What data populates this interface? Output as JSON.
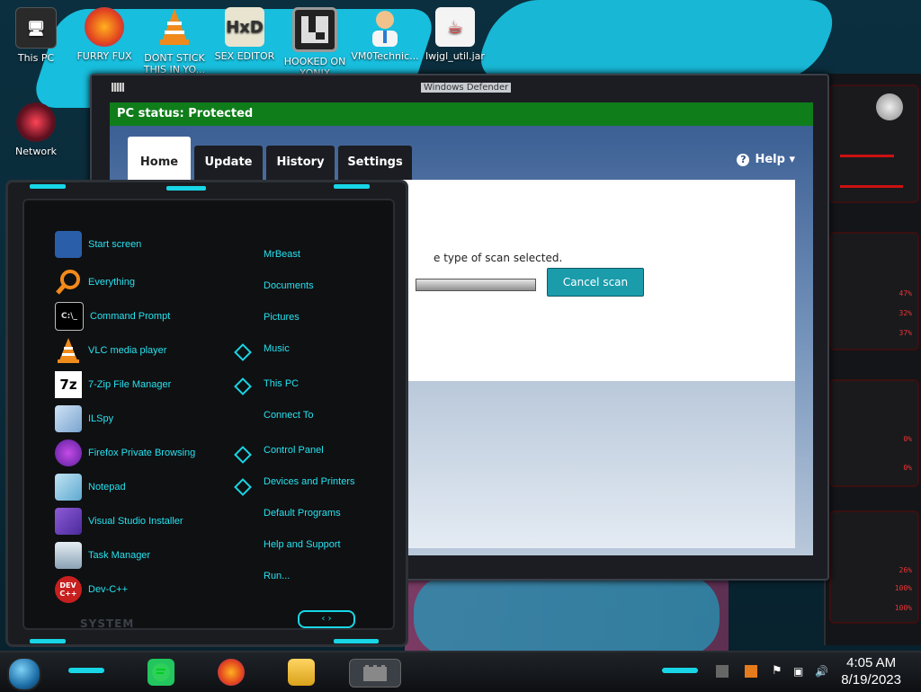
{
  "desktop": {
    "icons": [
      {
        "label": "This PC"
      },
      {
        "label": "FURRY FUX"
      },
      {
        "label": "DONT STICK THIS IN YO..."
      },
      {
        "label": "SEX EDITOR"
      },
      {
        "label": "HOOKED ON XONIX"
      },
      {
        "label": "VM0Technic..."
      },
      {
        "label": "lwjgl_util.jar"
      },
      {
        "label": "Network"
      }
    ]
  },
  "defender": {
    "window_title": "Windows Defender",
    "status": "PC status: Protected",
    "tabs": [
      {
        "label": "Home"
      },
      {
        "label": "Update"
      },
      {
        "label": "History"
      },
      {
        "label": "Settings"
      }
    ],
    "help_label": "Help",
    "scan_text": "e type of scan selected.",
    "cancel_label": "Cancel scan",
    "scan_progress": 0.95
  },
  "startmenu": {
    "apps": [
      {
        "label": "Start screen",
        "icon": "start-screen-icon"
      },
      {
        "label": "Everything",
        "icon": "magnifier-icon"
      },
      {
        "label": "Command Prompt",
        "icon": "console-icon"
      },
      {
        "label": "VLC media player",
        "icon": "vlc-cone-icon"
      },
      {
        "label": "7-Zip File Manager",
        "icon": "7zip-icon"
      },
      {
        "label": "ILSpy",
        "icon": "ilspy-icon"
      },
      {
        "label": "Firefox Private Browsing",
        "icon": "firefox-private-icon"
      },
      {
        "label": "Notepad",
        "icon": "notepad-icon"
      },
      {
        "label": "Visual Studio Installer",
        "icon": "vs-installer-icon"
      },
      {
        "label": "Task Manager",
        "icon": "task-manager-icon"
      },
      {
        "label": "Dev-C++",
        "icon": "devcpp-icon"
      }
    ],
    "places": [
      {
        "label": "MrBeast"
      },
      {
        "label": "Documents"
      },
      {
        "label": "Pictures"
      },
      {
        "label": "Music"
      },
      {
        "label": "This PC"
      },
      {
        "label": "Connect To"
      },
      {
        "label": "Control Panel"
      },
      {
        "label": "Devices and Printers"
      },
      {
        "label": "Default Programs"
      },
      {
        "label": "Help and Support"
      },
      {
        "label": "Run..."
      }
    ],
    "system_label": "SYSTEM"
  },
  "gadgets": {
    "values": [
      "47%",
      "32%",
      "37%",
      "0%",
      "0%",
      "26%",
      "100%",
      "100%"
    ]
  },
  "taskbar": {
    "time": "4:05 AM",
    "date": "8/19/2023"
  },
  "colors": {
    "accent": "#18d6e6",
    "status_green": "#0f7d1a",
    "cancel_button": "#1b9cab",
    "gadget_red": "#e33333"
  }
}
